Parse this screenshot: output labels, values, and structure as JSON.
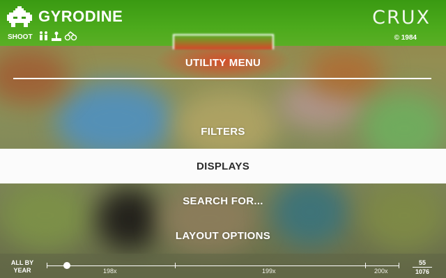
{
  "header": {
    "game_title": "GYRODINE",
    "genre": "SHOOT",
    "brand": "CRUX",
    "copyright": "© 1984",
    "logo_icon": "spaceship-logo-icon",
    "player_icons": [
      "two-players-icon",
      "joystick-icon",
      "controller-icon"
    ]
  },
  "menu": {
    "title": "UTILITY MENU",
    "items": [
      {
        "label": "FILTERS",
        "selected": false
      },
      {
        "label": "DISPLAYS",
        "selected": true
      },
      {
        "label": "SEARCH FOR...",
        "selected": false
      },
      {
        "label": "LAYOUT OPTIONS",
        "selected": false
      }
    ]
  },
  "footer": {
    "sort_line1": "ALL BY",
    "sort_line2": "YEAR",
    "decades": [
      "198x",
      "199x",
      "200x"
    ],
    "position_current": "55",
    "position_total": "1076"
  },
  "colors": {
    "header_green": "#4caa1c",
    "accent_red": "#d8452a",
    "selected_bg": "#fbfbfb",
    "selected_text": "#2b2b2b"
  }
}
